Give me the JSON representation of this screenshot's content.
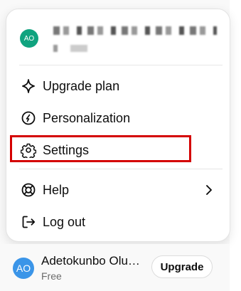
{
  "account": {
    "avatar_initials": "AO"
  },
  "menu": {
    "items": [
      {
        "label": "Upgrade plan",
        "icon": "sparkle-icon"
      },
      {
        "label": "Personalization",
        "icon": "personalization-icon"
      },
      {
        "label": "Settings",
        "icon": "gear-icon"
      },
      {
        "label": "Help",
        "icon": "lifebuoy-icon"
      },
      {
        "label": "Log out",
        "icon": "logout-icon"
      }
    ]
  },
  "footer": {
    "avatar_initials": "AO",
    "name": "Adetokunbo Olu…",
    "plan": "Free",
    "upgrade_label": "Upgrade"
  },
  "colors": {
    "highlight": "#d40000",
    "avatar_small": "#10a37f",
    "avatar_footer": "#3b95e8"
  }
}
